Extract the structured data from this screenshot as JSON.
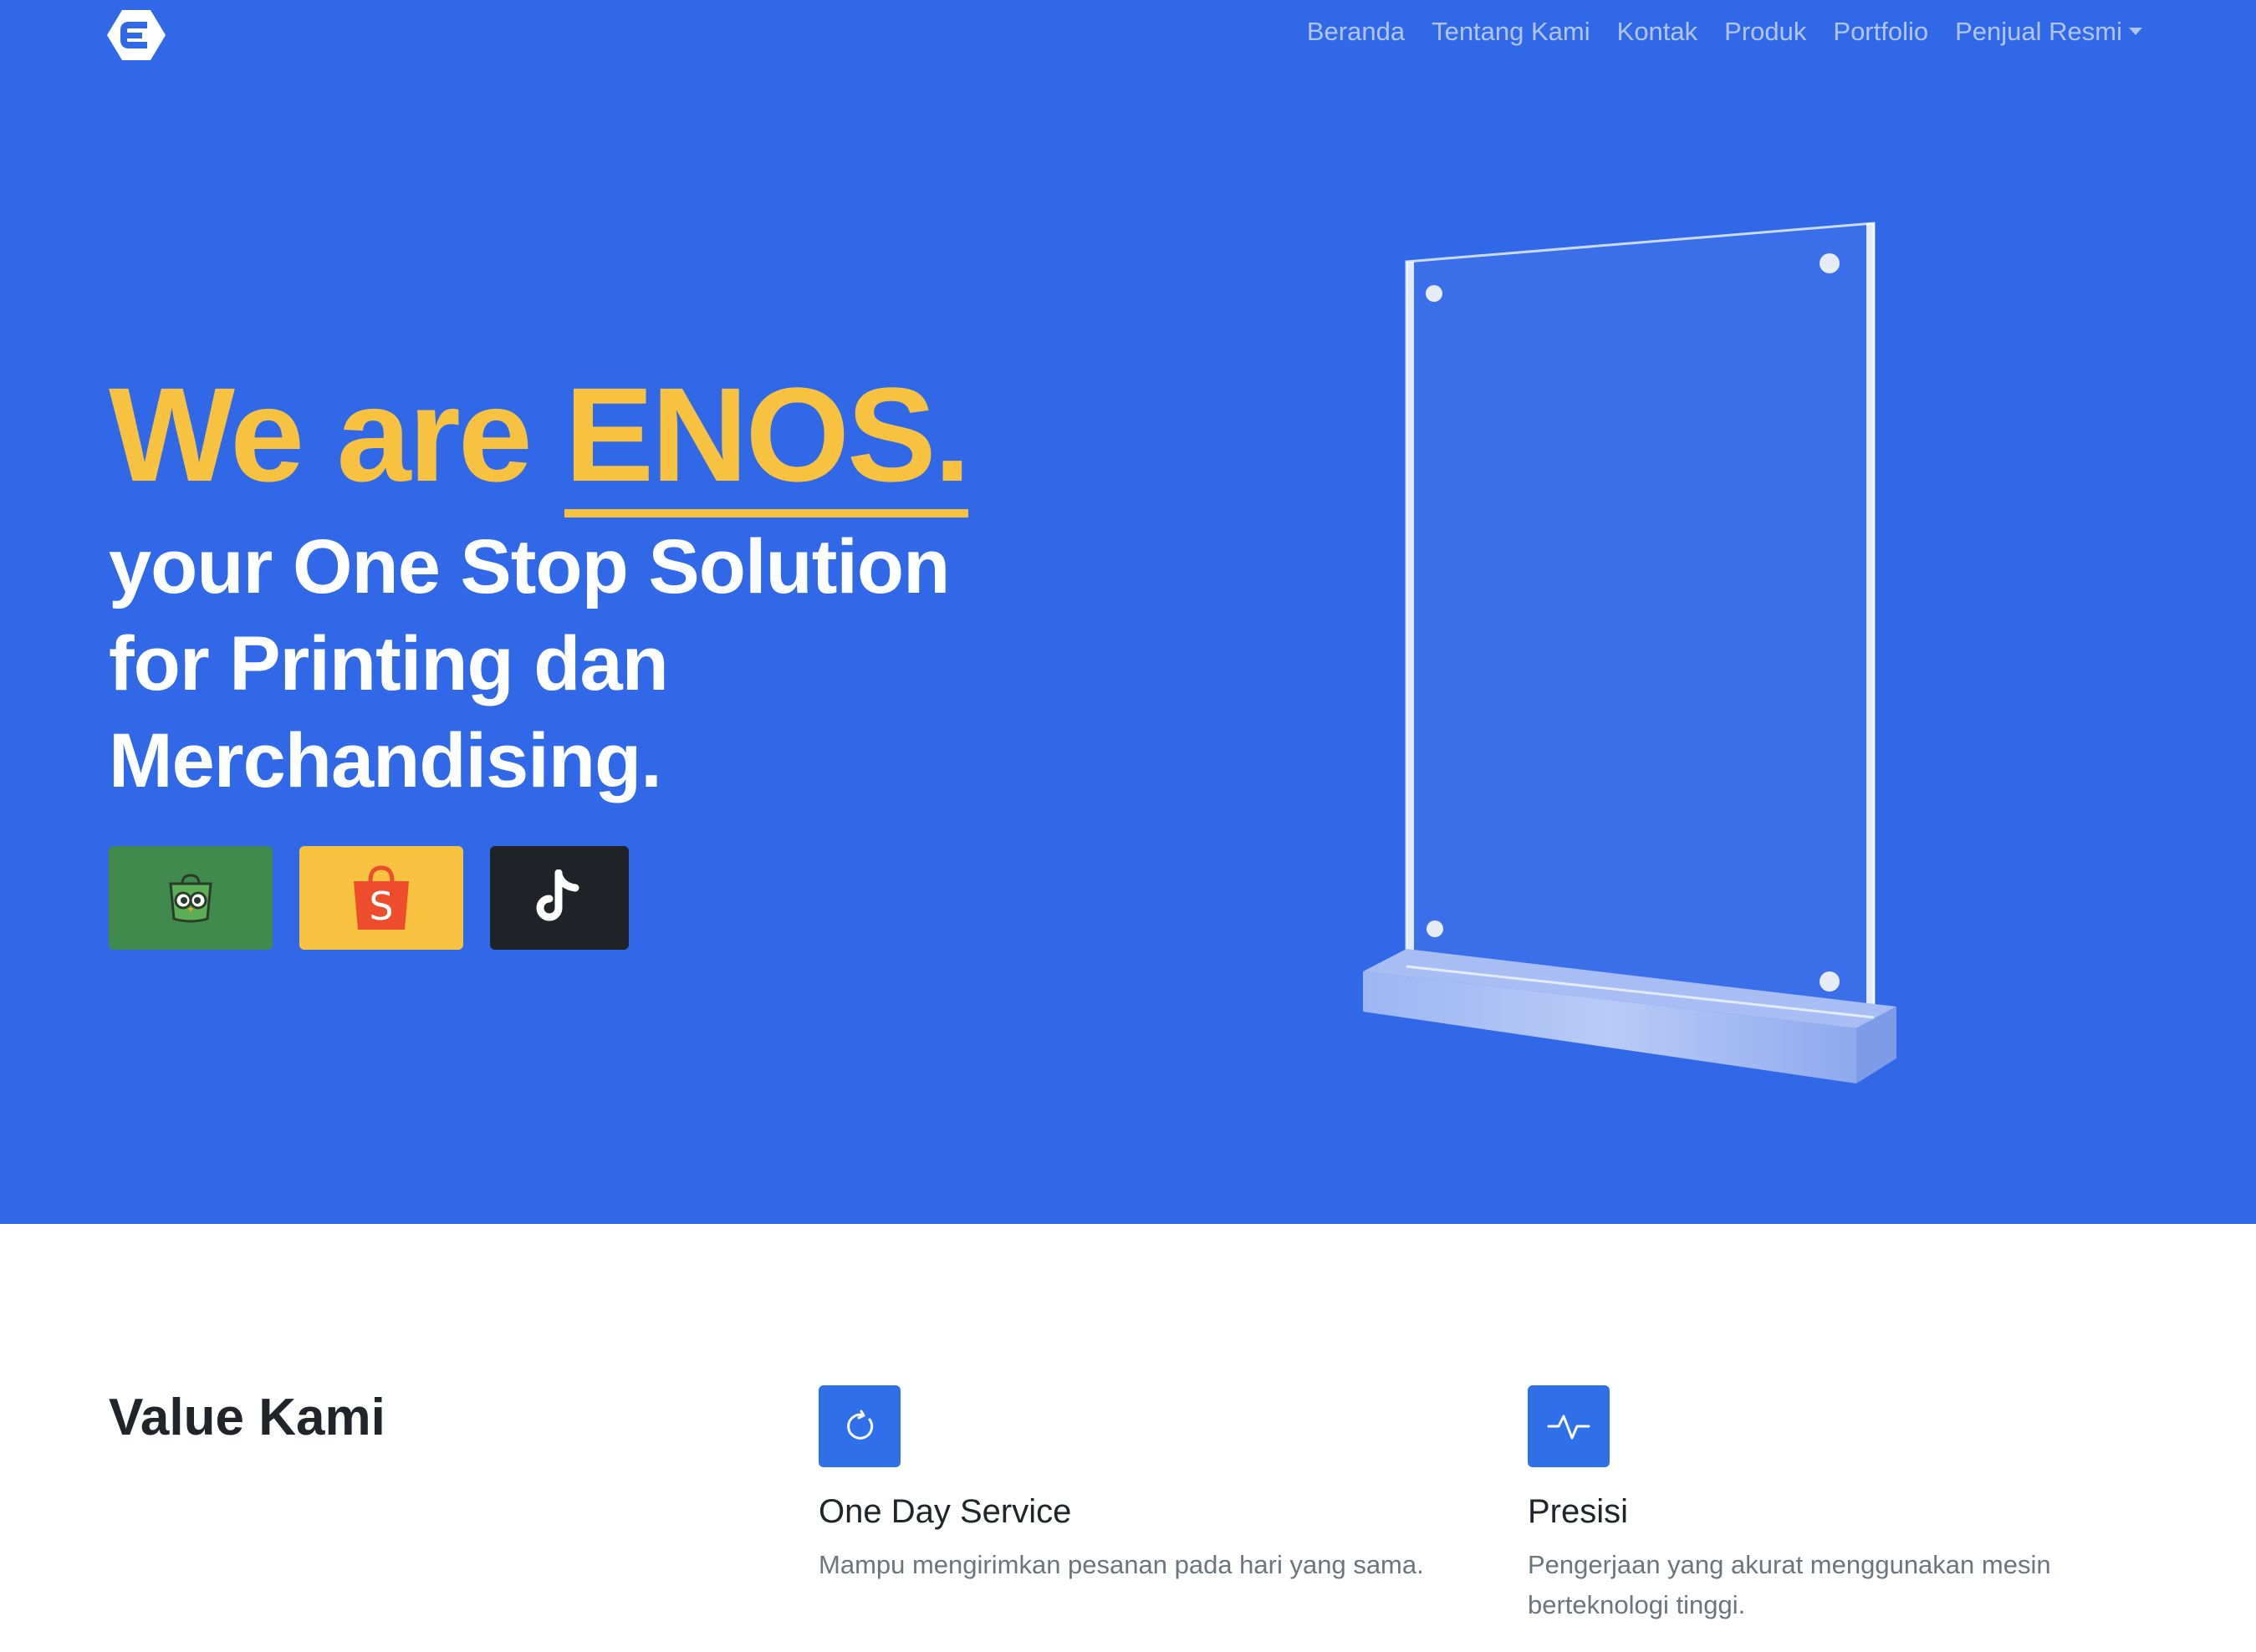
{
  "nav": {
    "logo_icon": "enos-logo-icon",
    "links": [
      "Beranda",
      "Tentang Kami",
      "Kontak",
      "Produk",
      "Portfolio"
    ],
    "dropdown_label": "Penjual Resmi"
  },
  "hero": {
    "headline_prefix": "We are ",
    "headline_brand": "ENOS.",
    "line1_a": "your ",
    "line1_b": "One Stop Solution",
    "line2": "for Printing dan",
    "line3": "Merchandising.",
    "stores": [
      {
        "name": "Tokopedia",
        "icon": "tokopedia-owl-icon",
        "color": "#3F8A4C"
      },
      {
        "name": "Shopee",
        "icon": "shopee-bag-icon",
        "color": "#F7C23F"
      },
      {
        "name": "TikTok",
        "icon": "tiktok-icon",
        "color": "#1F2226"
      }
    ],
    "colors": {
      "background": "#3168E8",
      "accent": "#F7C23F"
    }
  },
  "values": {
    "title": "Value Kami",
    "items": [
      {
        "icon": "refresh-icon",
        "title": "One Day Service",
        "desc": "Mampu mengirimkan pesanan pada hari yang sama."
      },
      {
        "icon": "activity-pulse-icon",
        "title": "Presisi",
        "desc": "Pengerjaan yang akurat menggunakan mesin berteknologi tinggi."
      }
    ]
  }
}
